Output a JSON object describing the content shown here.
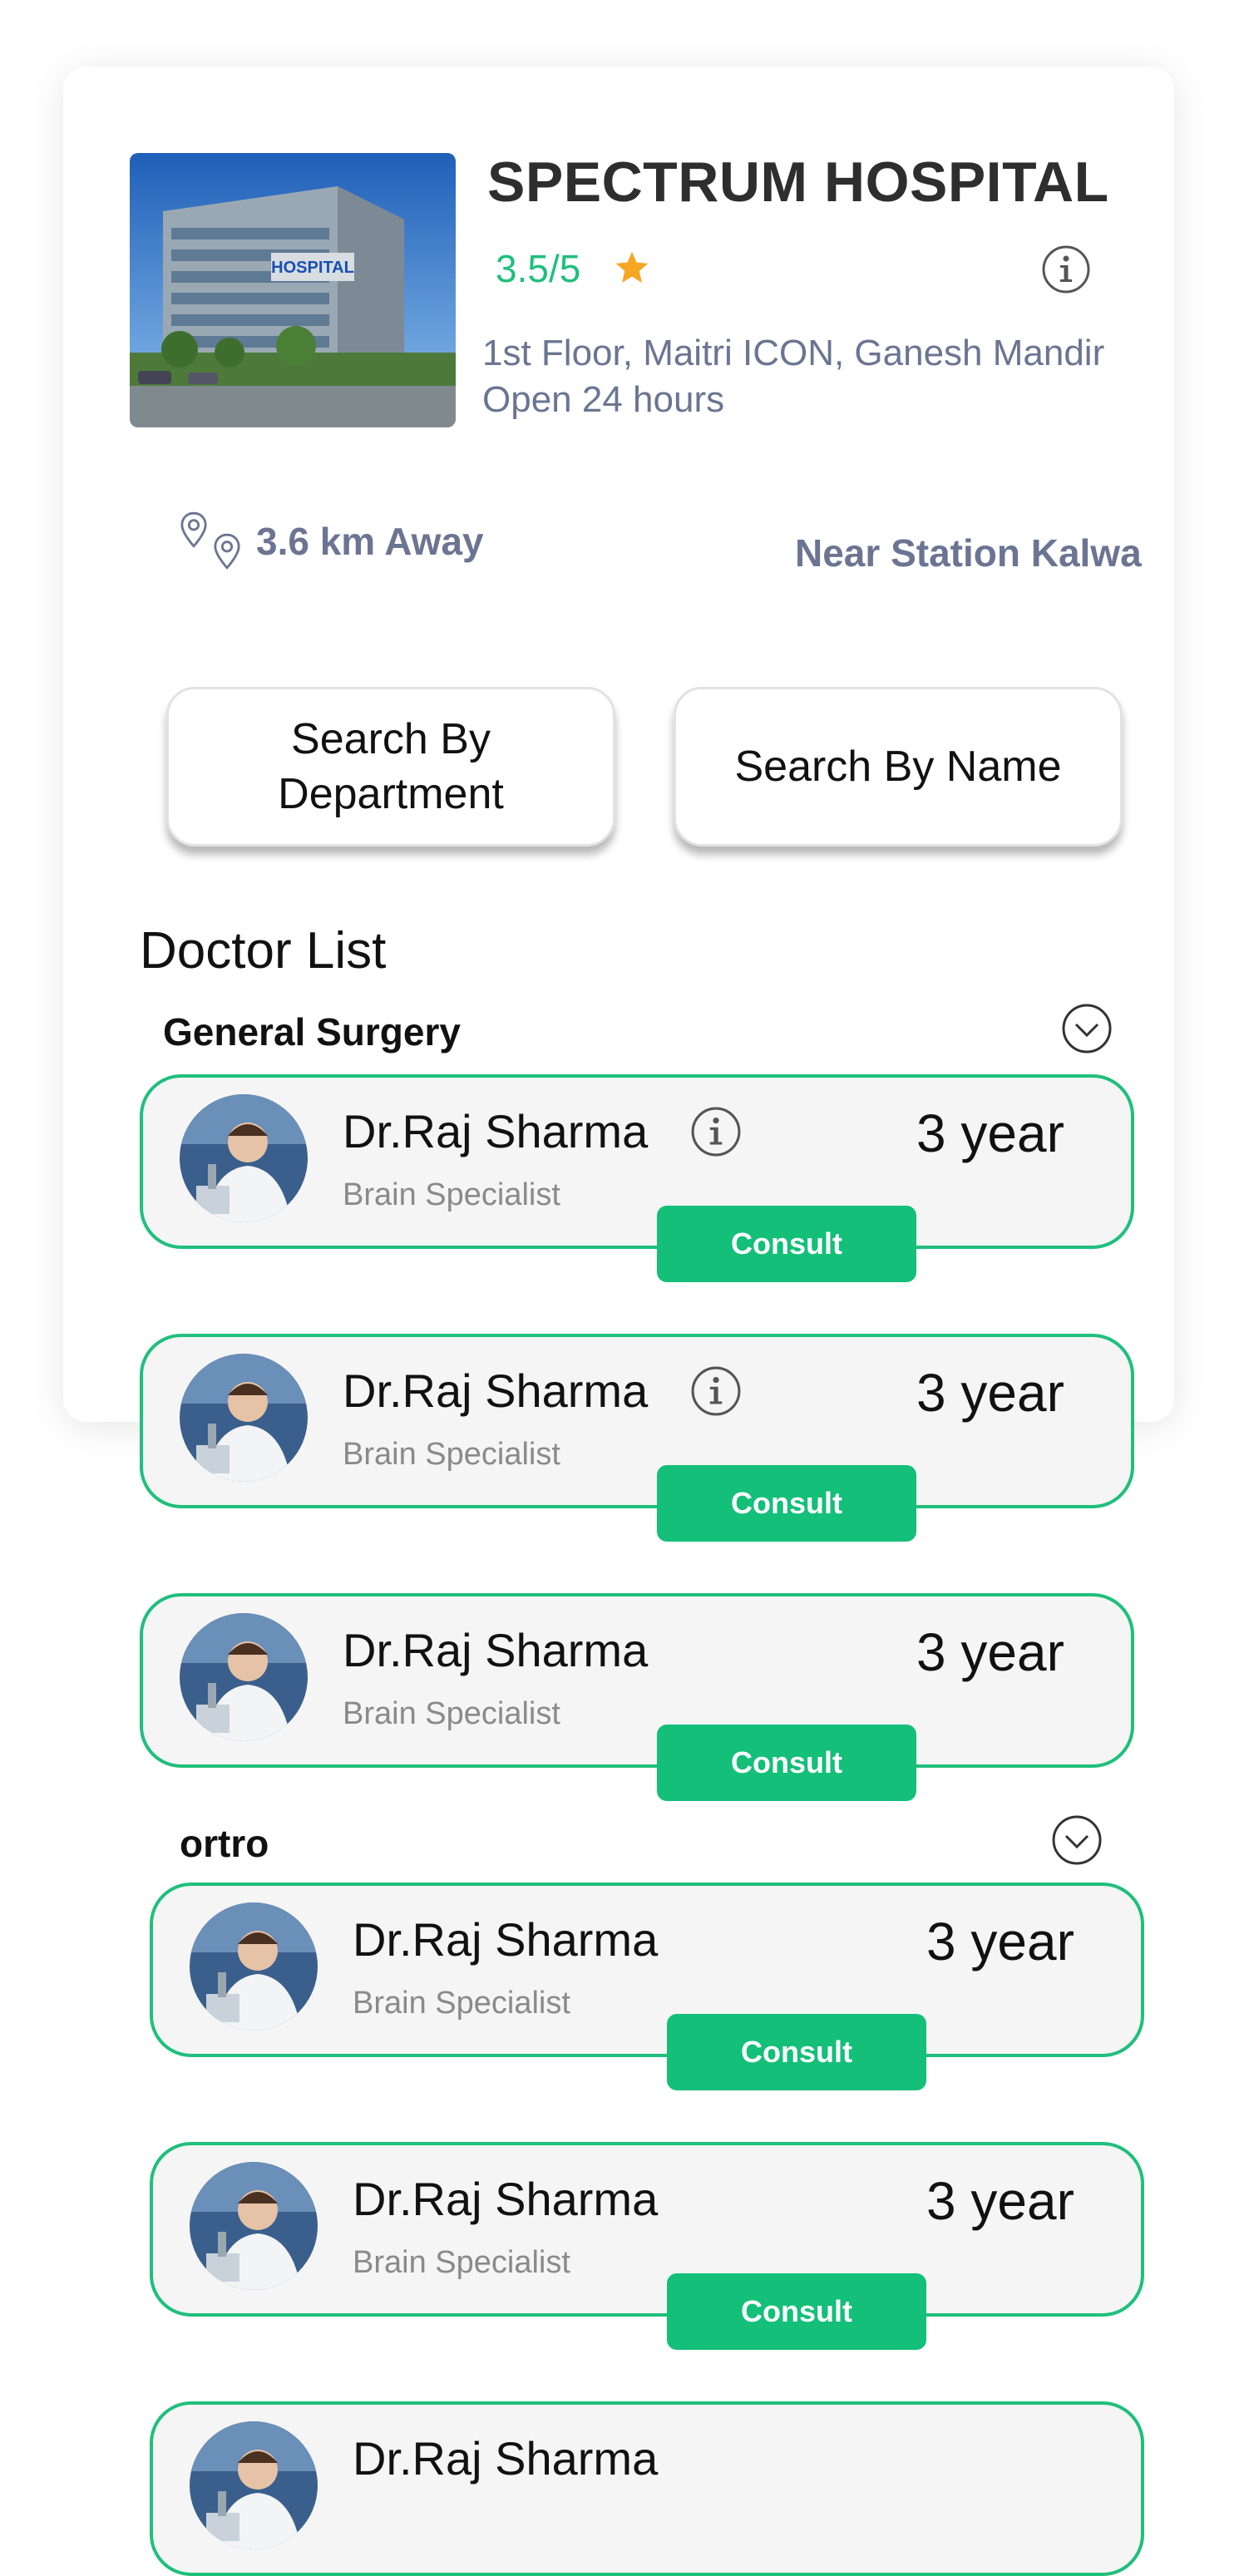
{
  "hospital": {
    "name": "SPECTRUM HOSPITAL",
    "rating": "3.5/5",
    "address_line1": "1st Floor, Maitri ICON,  Ganesh Mandir",
    "address_line2": "Open 24 hours",
    "distance": "3.6 km Away",
    "landmark": "Near Station Kalwa",
    "image_sign": "HOSPITAL"
  },
  "buttons": {
    "search_department": "Search By Department",
    "search_name": "Search By Name"
  },
  "doctor_list_title": "Doctor List",
  "sections": [
    {
      "title": "General Surgery",
      "doctors": [
        {
          "name": "Dr.Raj Sharma",
          "specialty": "Brain Specialist",
          "experience": "3 year",
          "consult": "Consult"
        },
        {
          "name": "Dr.Raj Sharma",
          "specialty": "Brain Specialist",
          "experience": "3 year",
          "consult": "Consult"
        },
        {
          "name": "Dr.Raj Sharma",
          "specialty": "Brain Specialist",
          "experience": "3 year",
          "consult": "Consult"
        }
      ]
    },
    {
      "title": "ortro",
      "doctors": [
        {
          "name": "Dr.Raj Sharma",
          "specialty": "Brain Specialist",
          "experience": "3 year",
          "consult": "Consult"
        },
        {
          "name": "Dr.Raj Sharma",
          "specialty": "Brain Specialist",
          "experience": "3 year",
          "consult": "Consult"
        },
        {
          "name": "Dr.Raj Sharma",
          "specialty": "",
          "experience": "",
          "consult": ""
        }
      ]
    }
  ],
  "colors": {
    "accent": "#13bf79",
    "rating": "#1fbf7c",
    "star": "#f5a623",
    "muted_text": "#6b7592"
  },
  "icons": [
    "info-icon",
    "star-icon",
    "location-pin-icon",
    "chevron-down-icon"
  ]
}
